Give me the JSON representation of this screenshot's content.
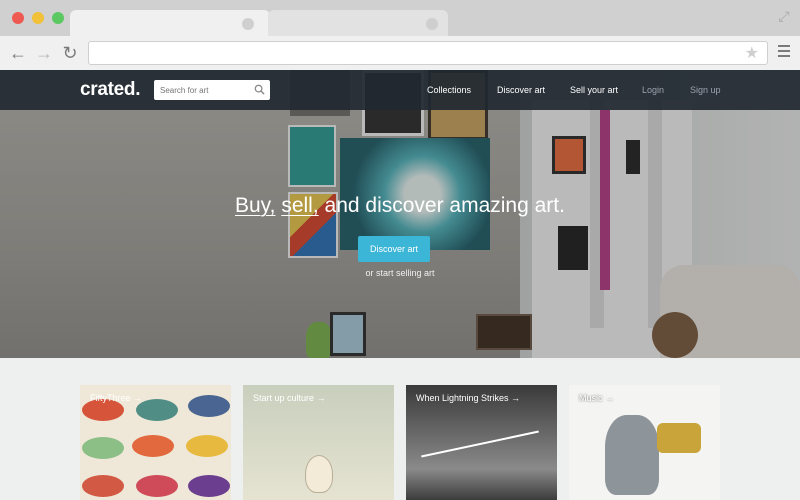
{
  "browser": {
    "address": ""
  },
  "navbar": {
    "logo": "crated.",
    "search_placeholder": "Search for art",
    "links": {
      "collections": "Collections",
      "discover": "Discover art",
      "sell": "Sell your art",
      "login": "Login",
      "signup": "Sign up"
    }
  },
  "hero": {
    "headline_words": [
      "Buy,",
      "sell,",
      "and discover amazing art."
    ],
    "cta_label": "Discover art",
    "subtext": "or start selling art"
  },
  "collections": [
    {
      "label": "FiftyThree →"
    },
    {
      "label": "Start up culture →"
    },
    {
      "label": "When Lightning Strikes →"
    },
    {
      "label": "Music →"
    }
  ],
  "colors": {
    "navbar": "#212831",
    "accent": "#3bb6d7"
  }
}
